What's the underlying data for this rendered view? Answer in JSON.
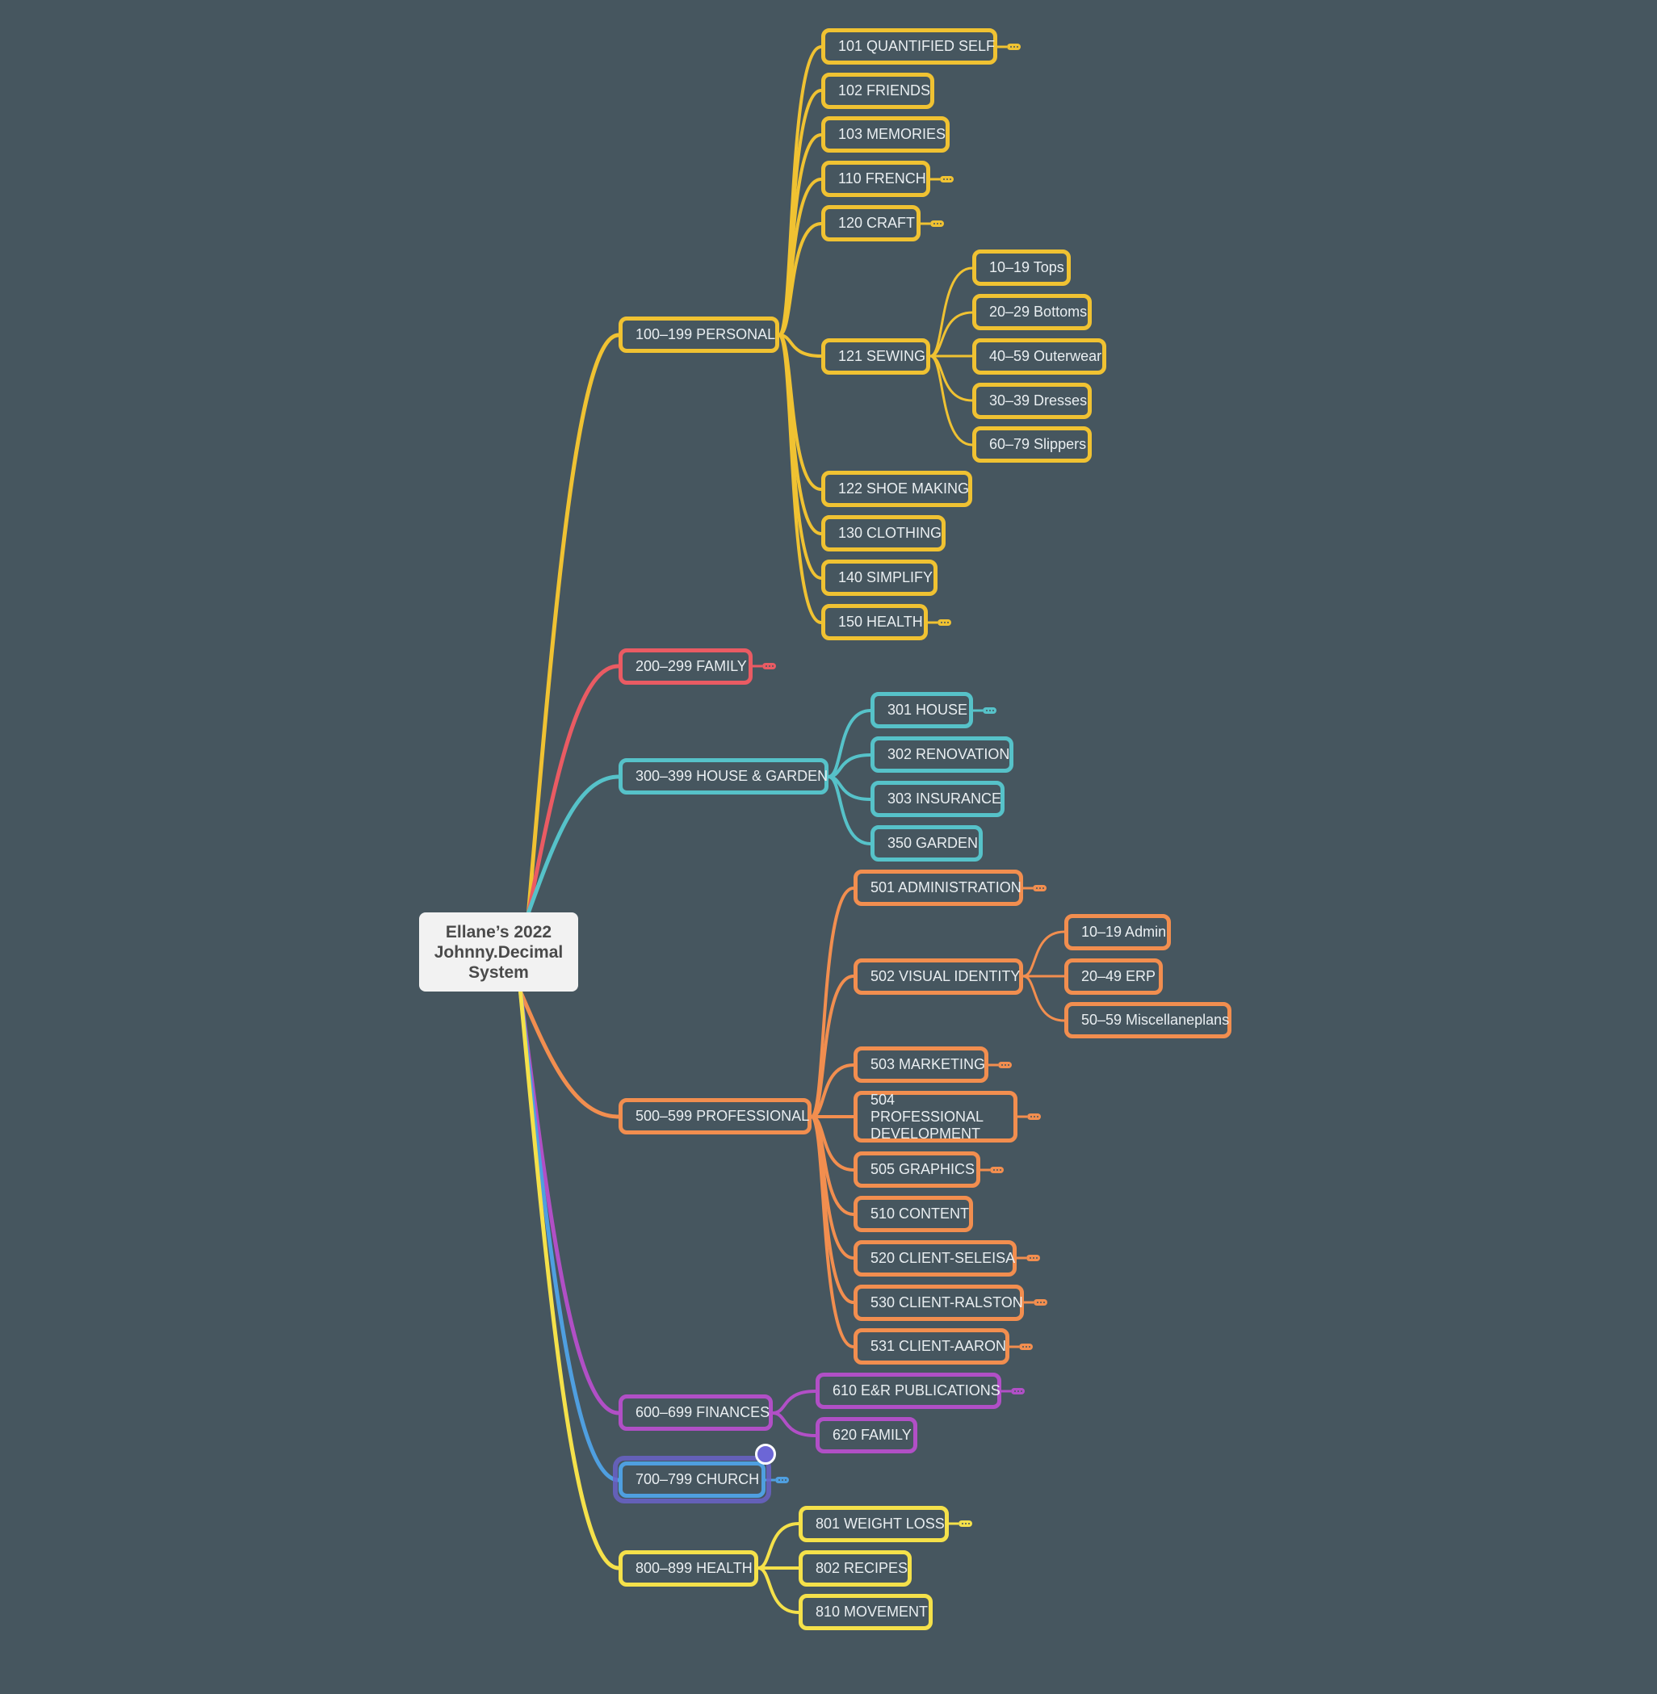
{
  "title": "Ellane's 2022 Johnny.Decimal System",
  "root": {
    "label": "Ellane’s 2022 Johnny.Decimal System",
    "lines": [
      "Ellane’s 2022",
      "Johnny.Decimal",
      "System"
    ]
  },
  "colors": {
    "background": "#46565f",
    "personal": "#f0c232",
    "family": "#ea5b63",
    "house": "#56c2c9",
    "professional": "#f28e4f",
    "finances": "#b14fc6",
    "church": "#4f9fe0",
    "health": "#f5e14a",
    "selection": "#6a62c8"
  },
  "branches": [
    {
      "label": "100–199 PERSONAL",
      "color_key": "personal",
      "children": [
        {
          "label": "101 QUANTIFIED SELF",
          "collapsed": true
        },
        {
          "label": "102 FRIENDS"
        },
        {
          "label": "103 MEMORIES"
        },
        {
          "label": "110 FRENCH",
          "collapsed": true
        },
        {
          "label": "120 CRAFT",
          "collapsed": true
        },
        {
          "label": "121 SEWING",
          "children": [
            {
              "label": "10–19 Tops"
            },
            {
              "label": "20–29 Bottoms"
            },
            {
              "label": "40–59 Outerwear"
            },
            {
              "label": "30–39 Dresses"
            },
            {
              "label": "60–79 Slippers"
            }
          ]
        },
        {
          "label": "122 SHOE MAKING"
        },
        {
          "label": "130 CLOTHING"
        },
        {
          "label": "140 SIMPLIFY"
        },
        {
          "label": "150 HEALTH",
          "collapsed": true
        }
      ]
    },
    {
      "label": "200–299 FAMILY",
      "color_key": "family",
      "collapsed": true,
      "children": []
    },
    {
      "label": "300–399 HOUSE & GARDEN",
      "color_key": "house",
      "children": [
        {
          "label": "301 HOUSE",
          "collapsed": true
        },
        {
          "label": "302 RENOVATION"
        },
        {
          "label": "303 INSURANCE"
        },
        {
          "label": "350 GARDEN"
        }
      ]
    },
    {
      "label": "500–599 PROFESSIONAL",
      "color_key": "professional",
      "children": [
        {
          "label": "501 ADMINISTRATION",
          "collapsed": true
        },
        {
          "label": "502 VISUAL IDENTITY",
          "children": [
            {
              "label": "10–19 Admin"
            },
            {
              "label": "20–49 ERP"
            },
            {
              "label": "50–59 Miscellaneplans"
            }
          ]
        },
        {
          "label": "503 MARKETING",
          "collapsed": true
        },
        {
          "label": "504 PROFESSIONAL DEVELOPMENT",
          "collapsed": true
        },
        {
          "label": "505 GRAPHICS",
          "collapsed": true
        },
        {
          "label": "510 CONTENT"
        },
        {
          "label": "520 CLIENT-SELEISA",
          "collapsed": true
        },
        {
          "label": "530 CLIENT-RALSTON",
          "collapsed": true
        },
        {
          "label": "531 CLIENT-AARON",
          "collapsed": true
        }
      ]
    },
    {
      "label": "600–699 FINANCES",
      "color_key": "finances",
      "children": [
        {
          "label": "610 E&R PUBLICATIONS",
          "collapsed": true
        },
        {
          "label": "620 FAMILY"
        }
      ]
    },
    {
      "label": "700–799 CHURCH",
      "color_key": "church",
      "collapsed": true,
      "selected": true,
      "children": []
    },
    {
      "label": "800–899 HEALTH",
      "color_key": "health",
      "children": [
        {
          "label": "801 WEIGHT LOSS",
          "collapsed": true
        },
        {
          "label": "802 RECIPES"
        },
        {
          "label": "810 MOVEMENT"
        }
      ]
    }
  ]
}
